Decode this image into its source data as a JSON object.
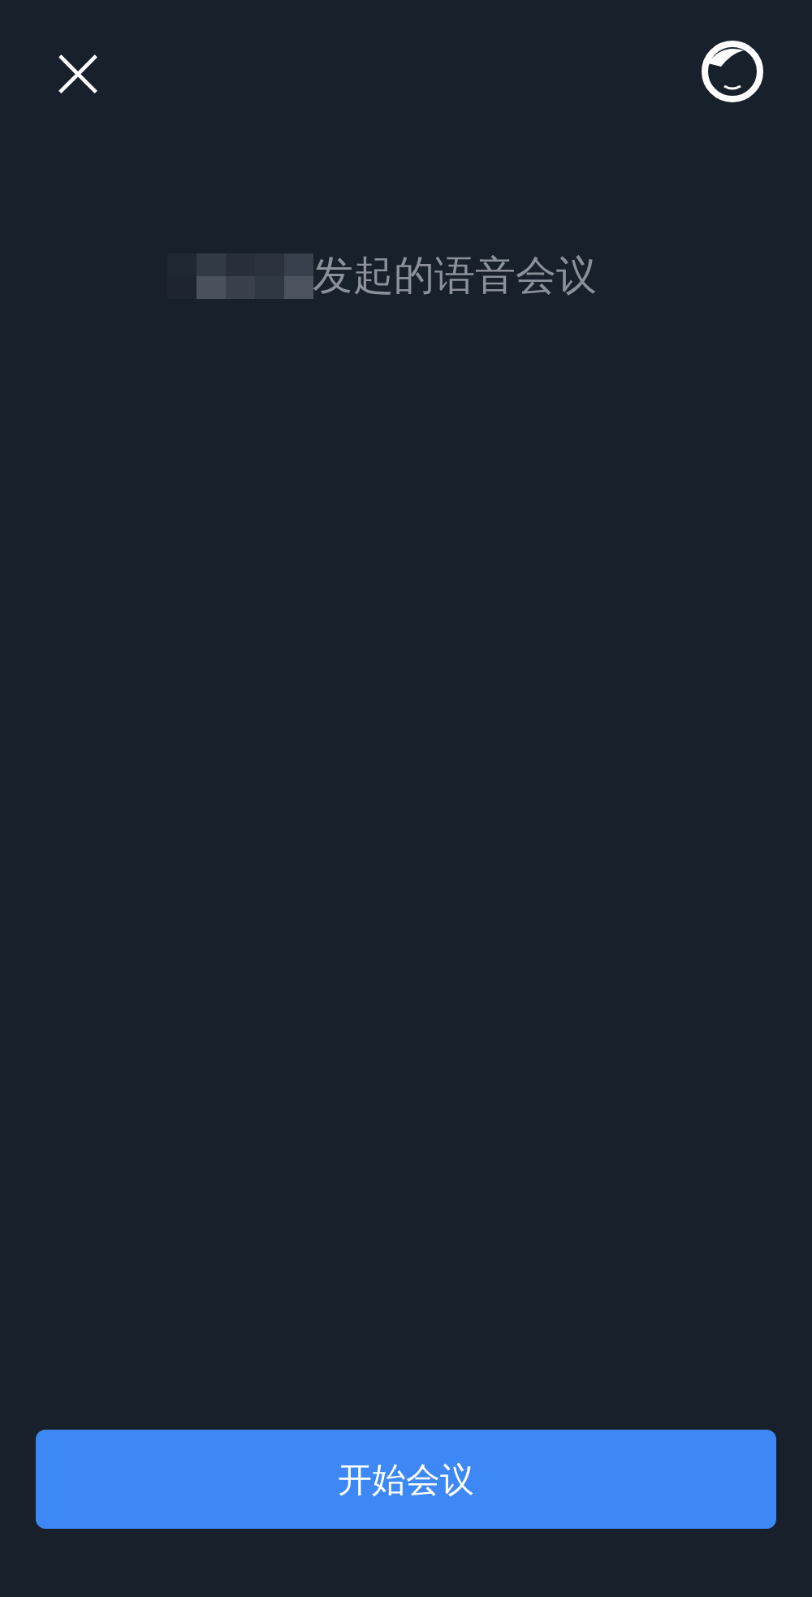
{
  "header": {
    "close_label": "×"
  },
  "invite": {
    "text": "发起的语音会议"
  },
  "start_button": {
    "label": "开始会议"
  }
}
